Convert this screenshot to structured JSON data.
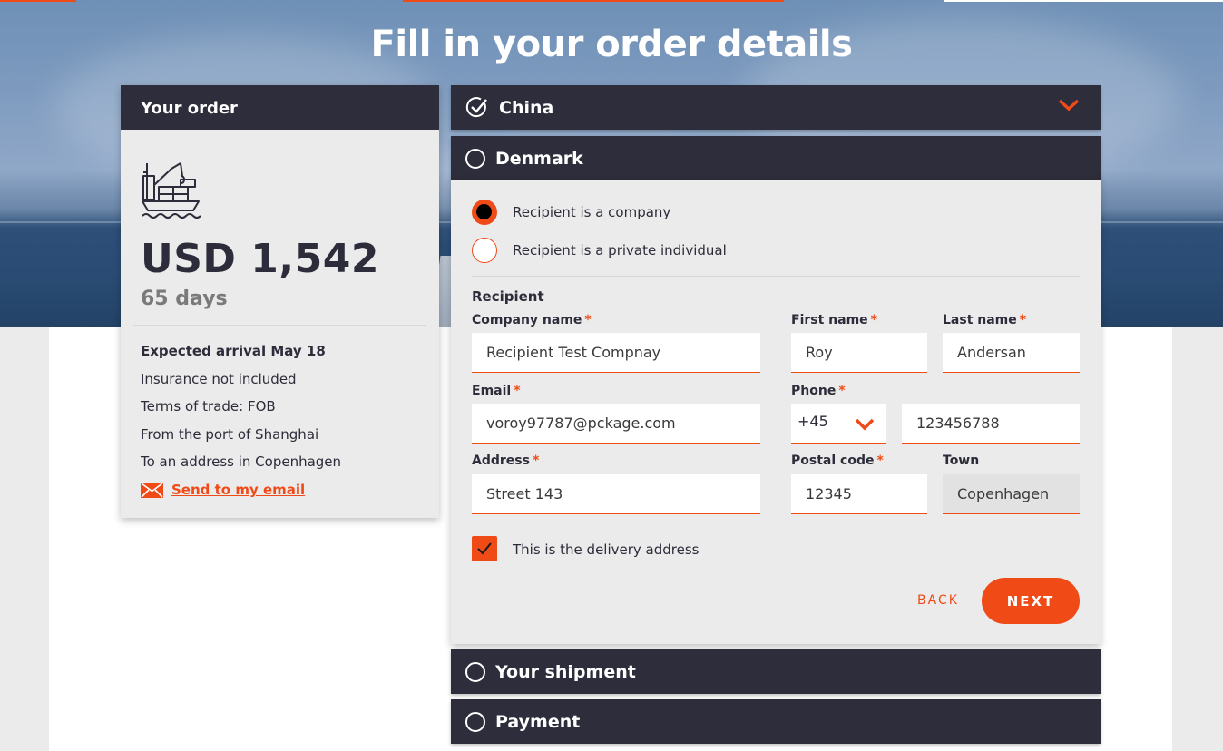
{
  "page": {
    "title": "Fill in your order details"
  },
  "colors": {
    "accent": "#f04a17",
    "dark": "#2d2d3b",
    "panel": "#ebebeb"
  },
  "order": {
    "heading": "Your order",
    "icon": "cargo-ship-icon",
    "price": "USD 1,542",
    "duration": "65 days",
    "arrival": "Expected arrival May 18",
    "insurance": "Insurance not included",
    "terms": "Terms of trade: FOB",
    "from": "From the port of Shanghai",
    "to": "To an address in Copenhagen",
    "email_link": "Send to my email"
  },
  "steps": {
    "china": {
      "label": "China"
    },
    "denmark": {
      "label": "Denmark"
    },
    "shipment": {
      "label": "Your shipment"
    },
    "payment": {
      "label": "Payment"
    }
  },
  "form": {
    "recipient_type": {
      "company": "Recipient is a company",
      "private": "Recipient is a private individual"
    },
    "section": "Recipient",
    "required_mark": "*",
    "company_name": {
      "label": "Company name",
      "value": "Recipient Test Compnay"
    },
    "first_name": {
      "label": "First name",
      "value": "Roy"
    },
    "last_name": {
      "label": "Last name",
      "value": "Andersan"
    },
    "email": {
      "label": "Email",
      "value": "voroy97787@pckage.com"
    },
    "phone": {
      "label": "Phone",
      "code": "+45",
      "value": "123456788"
    },
    "address": {
      "label": "Address",
      "value": "Street 143"
    },
    "postal_code": {
      "label": "Postal code",
      "value": "12345"
    },
    "town": {
      "label": "Town",
      "value": "Copenhagen"
    },
    "delivery_checkbox": "This is the delivery address",
    "back": "BACK",
    "next": "NEXT"
  }
}
